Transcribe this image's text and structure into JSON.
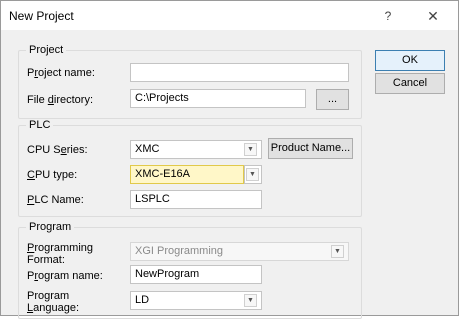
{
  "window": {
    "title": "New Project",
    "help": "?",
    "close_glyph": "✕"
  },
  "buttons": {
    "ok": "OK",
    "cancel": "Cancel",
    "browse": "...",
    "product_name": "Product Name..."
  },
  "project": {
    "legend": "Project",
    "name_label": {
      "pre": "P",
      "key": "r",
      "post": "oject name:"
    },
    "name_value": "",
    "dir_label": {
      "pre": "File ",
      "key": "d",
      "post": "irectory:"
    },
    "dir_value": "C:\\Projects"
  },
  "plc": {
    "legend": "PLC",
    "series_label": {
      "pre": "CPU S",
      "key": "e",
      "post": "ries:"
    },
    "series_value": "XMC",
    "type_label": {
      "pre": "",
      "key": "C",
      "post": "PU type:"
    },
    "type_value": "XMC-E16A",
    "name_label": {
      "pre": "",
      "key": "P",
      "post": "LC Name:"
    },
    "name_value": "LSPLC"
  },
  "program": {
    "legend": "Program",
    "format_label_line1": {
      "pre": "",
      "key": "P",
      "post": "rogramming"
    },
    "format_label_line2": "Format:",
    "format_value": "XGI Programming",
    "name_label": {
      "pre": "P",
      "key": "r",
      "post": "ogram name:"
    },
    "name_value": "NewProgram",
    "lang_label_line1": "Program",
    "lang_label_line2": {
      "pre": "",
      "key": "L",
      "post": "anguage:"
    },
    "lang_value": "LD"
  },
  "icons": {
    "dropdown": "chevron-down-icon",
    "close": "close-icon"
  },
  "colors": {
    "highlight": "#fff7c8",
    "default_button_border": "#3c7fb1"
  }
}
